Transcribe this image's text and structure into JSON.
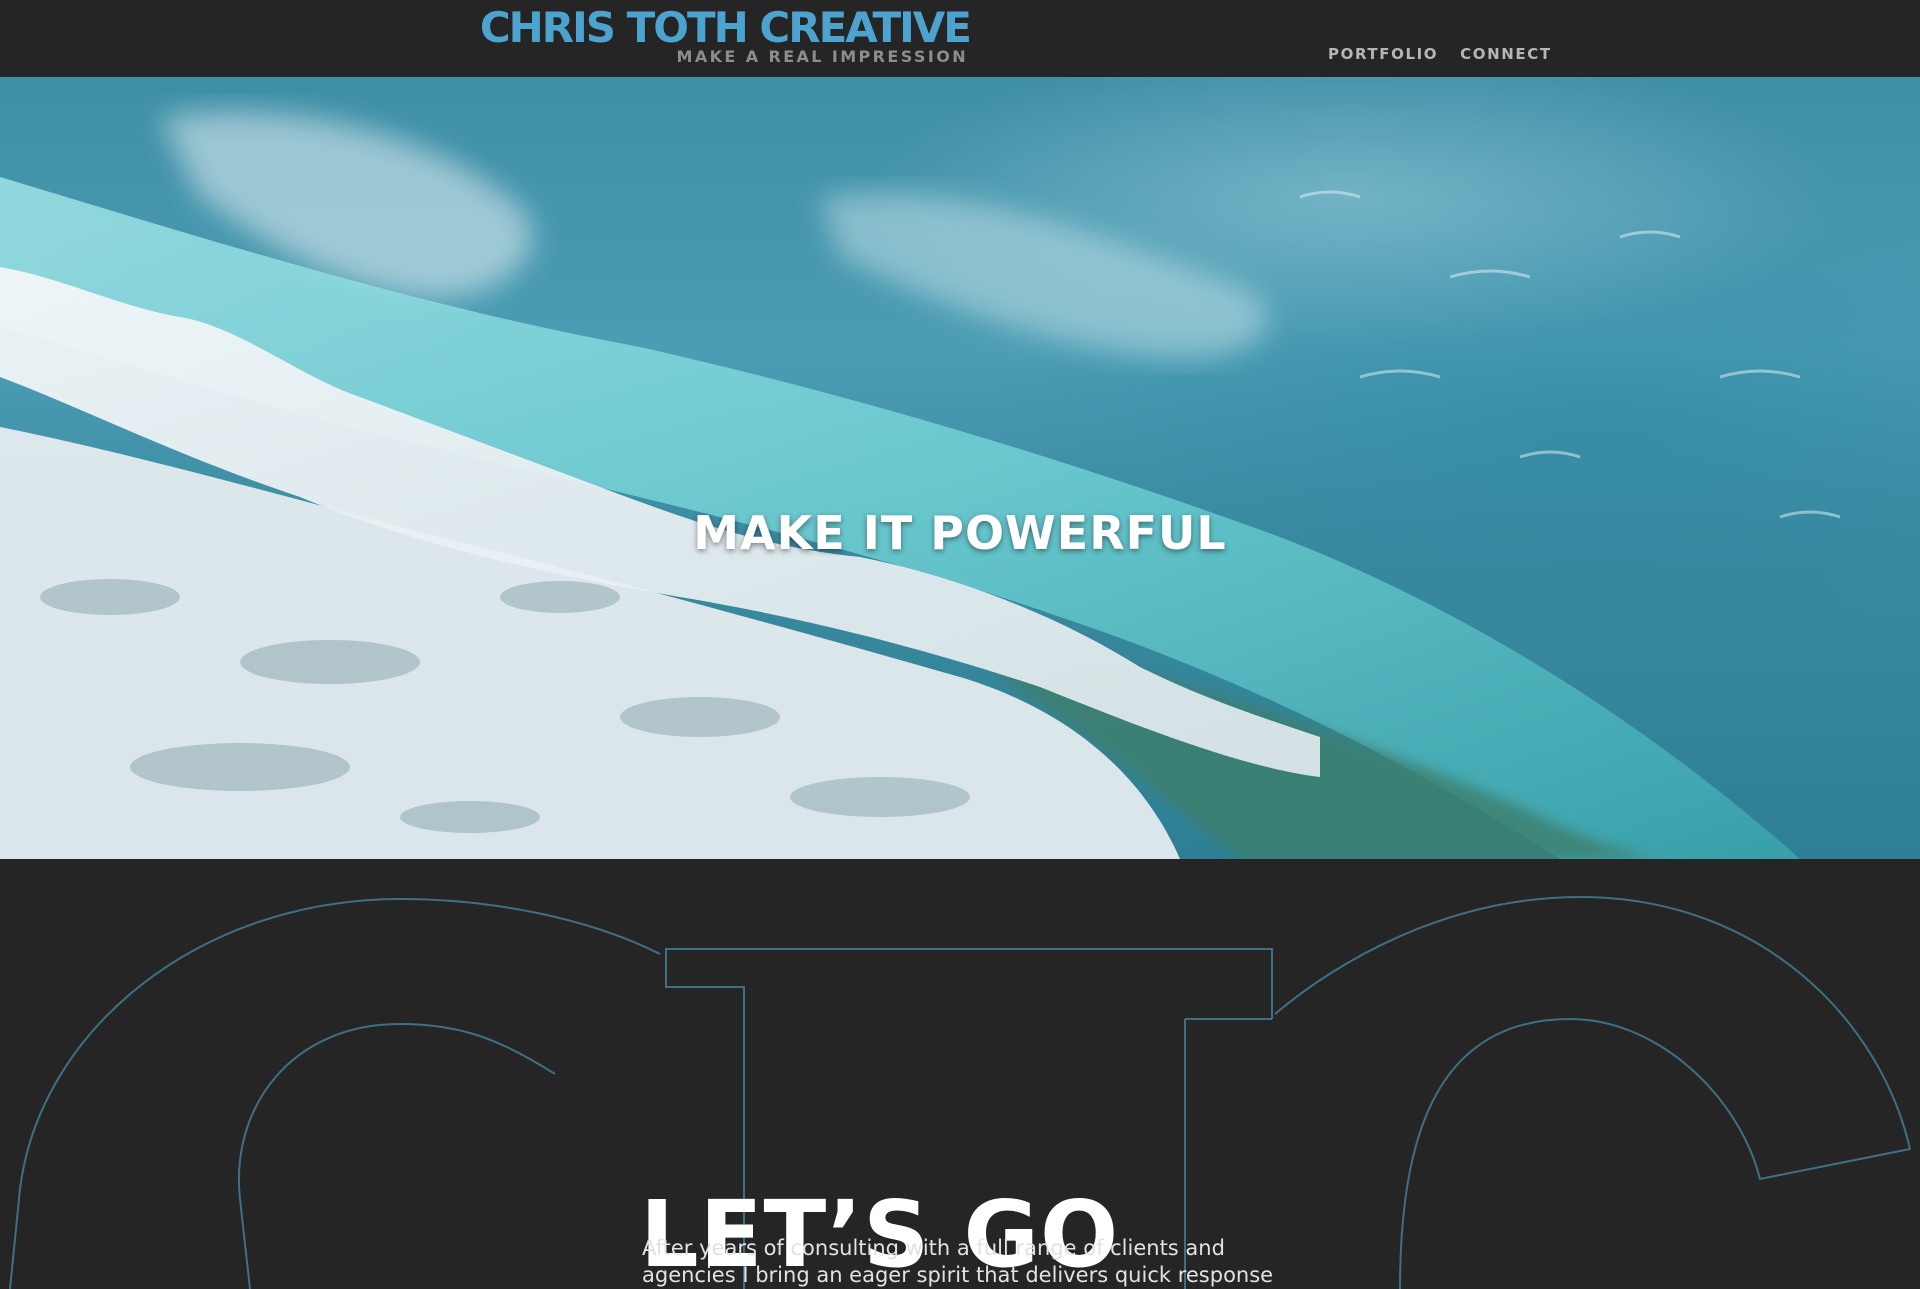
{
  "brand": {
    "name": "CHRIS TOTH CREATIVE",
    "tagline": "MAKE A REAL IMPRESSION",
    "color": "#4ca3cf"
  },
  "nav": {
    "items": [
      {
        "label": "PORTFOLIO"
      },
      {
        "label": "CONNECT"
      }
    ]
  },
  "hero": {
    "headline": "MAKE IT POWERFUL",
    "image": "ocean-wave-photo"
  },
  "intro": {
    "watermark": "CTC",
    "heading": "LET’S GO",
    "body": "After years of consulting with a full range of clients and agencies I bring an eager spirit that delivers quick response and smart solutions."
  },
  "colors": {
    "background": "#252525",
    "accent": "#4ca3cf",
    "nav_text": "#b6b6b6",
    "outline": "#3f6f85"
  }
}
